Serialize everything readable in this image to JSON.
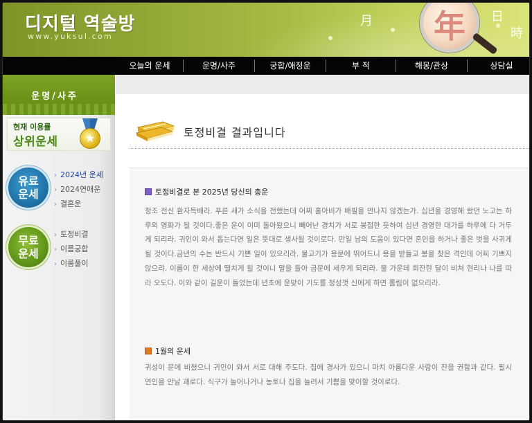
{
  "header": {
    "site_title": "디지털 역술방",
    "site_url": "www.yuksul.com",
    "hanja": {
      "month": "月",
      "year": "年",
      "day": "日",
      "time": "時"
    }
  },
  "nav": {
    "items": [
      "오늘의 운세",
      "운명/사주",
      "궁합/애정운",
      "부 적",
      "해몽/관상",
      "상담실"
    ]
  },
  "sidebar": {
    "title": "운명/사주",
    "banner": {
      "small": "현재 이용률",
      "big": "상위운세",
      "medal_icon": "star-medal-icon"
    },
    "paid": {
      "badge": [
        "유료",
        "운세"
      ],
      "links": [
        "2024년 운세",
        "2024연애운",
        "결혼운"
      ]
    },
    "free": {
      "badge": [
        "무료",
        "운세"
      ],
      "links": [
        "토정비결",
        "이름궁합",
        "이름풀이"
      ]
    }
  },
  "main": {
    "title": "토정비결 결과입니다",
    "sections": [
      {
        "heading": "토정비결로 본 2025년 당신의 총운",
        "body": "청조 전신 환자득배라. 푸른 새가 소식을 전했는데 어찌 홀아비가 배필을 만나지 않겠는가. 십년을 경영해 왔던 노고는 하루의 영화가 될 것이다.좋은 운이 이미 돌아왔으니 빼어난 경치가 서로 붕접한 듯하여 십년 경영한 대가를 하루에 다 거두게 되리라. 귀인이 와서 돕는다면 일은 뜻대로 생사될 것이로다. 만일 남의 도움이 있다면 혼인을 하거나 좋은 벗을 사귀게 될 것이다.금년의 수는 반드시 기쁜 일이 있으리라. 물고기가 용문에 뛰어드니 용을 받들고 봉을 찾은 격인데 어찌 기쁘지 않으랴. 이름이 한 세상에 떨치게 될 것이니 말을 돌아 금문에 세우게 되리라. 물 가운데 희잔한 달이 비쳐 현리나 나를 따라 오도다. 이와 같이 길운이 들었는데 년초에 운맞이 기도를 정성껏 신에게 하면 롤림이 없으리라."
      },
      {
        "heading": "1월의 운세",
        "body": "귀성이 문에 비쳤으니 귀인이 와서 서로 대해 주도다. 집에 경사가 있으니 마치 아름다운 사람이 잔을 권함과 같다. 필시 연인을 만날 괘로다. 식구가 늘어나거나 농토나 집을 늘려서 기쁨을 맞이할 것이로다."
      }
    ]
  },
  "colors": {
    "header_green": "#93a936",
    "nav_black": "#050505",
    "sidebar_green": "#6b9219",
    "paid_blue": "#1f73a8",
    "free_green": "#5f9418",
    "section1_bullet": "#7a5fc4",
    "section2_bullet": "#e07a24"
  }
}
